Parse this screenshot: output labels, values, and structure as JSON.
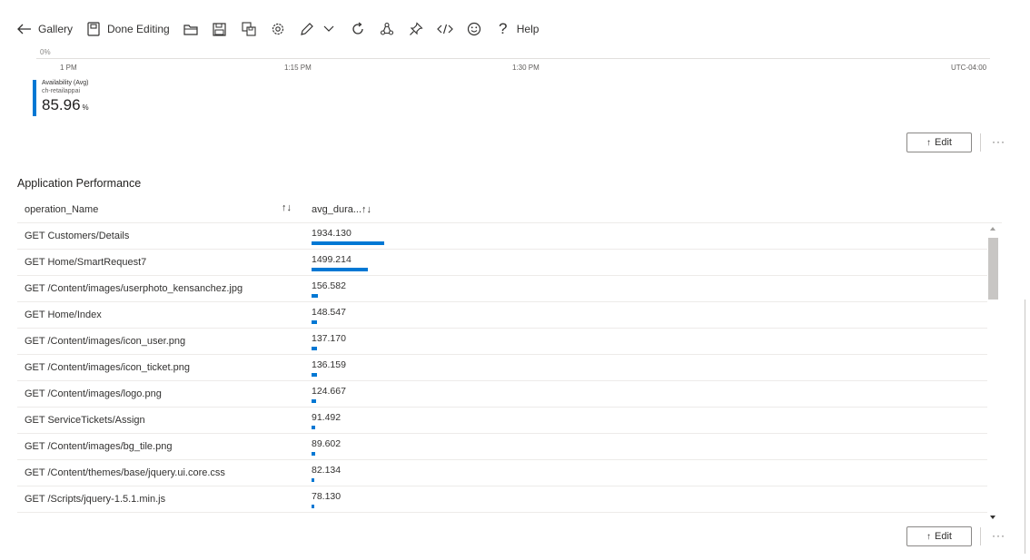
{
  "toolbar": {
    "back_label": "Gallery",
    "done_label": "Done Editing",
    "help_label": "Help",
    "icons": [
      "back-arrow-icon",
      "done-editing-icon",
      "open-folder-icon",
      "save-icon",
      "save-as-icon",
      "settings-icon",
      "edit-pencil-icon",
      "chevron-down-icon",
      "refresh-icon",
      "share-icon",
      "pin-icon",
      "code-icon",
      "feedback-smiley-icon",
      "help-icon"
    ]
  },
  "chart": {
    "zero_label": "0%",
    "ticks": [
      "1 PM",
      "1:15 PM",
      "1:30 PM"
    ],
    "timezone": "UTC-04:00",
    "legend": {
      "metric": "Availability (Avg)",
      "resource": "ch-retailappai",
      "value": "85.96",
      "unit": "%"
    },
    "accent_color": "#0078d4"
  },
  "edit_button_label": "Edit",
  "more_label": "···",
  "section": {
    "title": "Application Performance"
  },
  "table": {
    "columns": [
      "operation_Name",
      "avg_dura..."
    ],
    "sort_glyph": "↑↓",
    "rows": [
      {
        "op": "GET Customers/Details",
        "val": "1934.130",
        "n": 1934.13
      },
      {
        "op": "GET Home/SmartRequest7",
        "val": "1499.214",
        "n": 1499.214
      },
      {
        "op": "GET /Content/images/userphoto_kensanchez.jpg",
        "val": "156.582",
        "n": 156.582
      },
      {
        "op": "GET Home/Index",
        "val": "148.547",
        "n": 148.547
      },
      {
        "op": "GET /Content/images/icon_user.png",
        "val": "137.170",
        "n": 137.17
      },
      {
        "op": "GET /Content/images/icon_ticket.png",
        "val": "136.159",
        "n": 136.159
      },
      {
        "op": "GET /Content/images/logo.png",
        "val": "124.667",
        "n": 124.667
      },
      {
        "op": "GET ServiceTickets/Assign",
        "val": "91.492",
        "n": 91.492
      },
      {
        "op": "GET /Content/images/bg_tile.png",
        "val": "89.602",
        "n": 89.602
      },
      {
        "op": "GET /Content/themes/base/jquery.ui.core.css",
        "val": "82.134",
        "n": 82.134
      },
      {
        "op": "GET /Scripts/jquery-1.5.1.min.js",
        "val": "78.130",
        "n": 78.13
      }
    ],
    "max_value": 1934.13
  }
}
